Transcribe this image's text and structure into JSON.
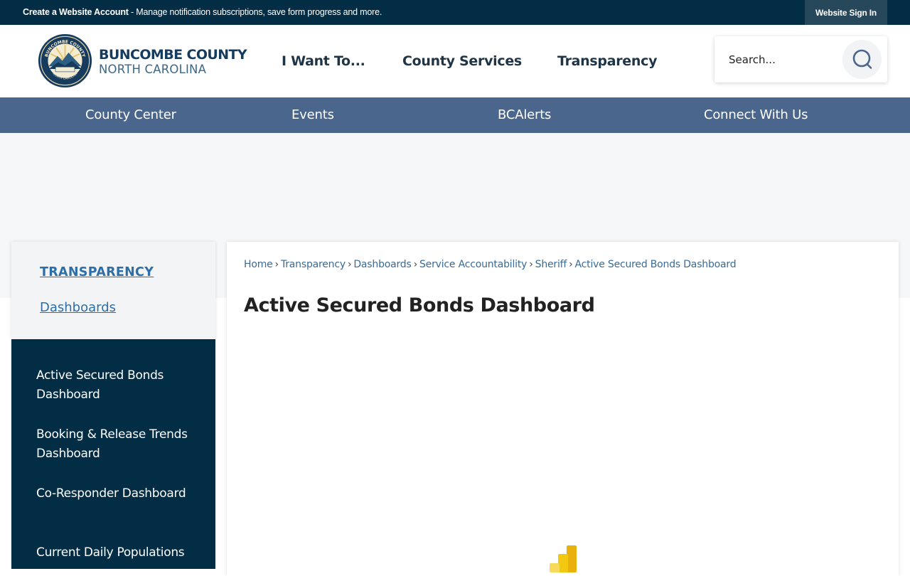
{
  "topbar": {
    "account_link": "Create a Website Account",
    "account_desc": " - Manage notification subscriptions, save form progress and more.",
    "sign_in": "Website Sign In"
  },
  "header": {
    "logo_line1": "BUNCOMBE COUNTY",
    "logo_line2": "NORTH CAROLINA",
    "seal_text_top": "BUNCOMBE COUNTY",
    "seal_text_bottom": "NORTH CAROLINA",
    "nav": [
      "I Want To...",
      "County Services",
      "Transparency"
    ],
    "search_placeholder": "Search..."
  },
  "subnav": [
    "County Center",
    "Events",
    "BCAlerts",
    "Connect With Us"
  ],
  "sidebar": {
    "section": "TRANSPARENCY",
    "subsection": "Dashboards",
    "items": [
      "Active Secured Bonds Dashboard",
      "Booking & Release Trends Dashboard",
      "Co-Responder Dashboard",
      "Current Daily Populations"
    ]
  },
  "breadcrumb": [
    "Home",
    "Transparency",
    "Dashboards",
    "Service Accountability",
    "Sheriff",
    "Active Secured Bonds Dashboard"
  ],
  "page_title": "Active Secured Bonds Dashboard",
  "colors": {
    "navy": "#022d45",
    "subnav_blue": "#4b668c",
    "link_blue": "#2c6ea8",
    "powerbi_yellow": "#f2c811"
  },
  "icons": {
    "search": "search-icon",
    "embed_loader": "power-bi-icon"
  }
}
